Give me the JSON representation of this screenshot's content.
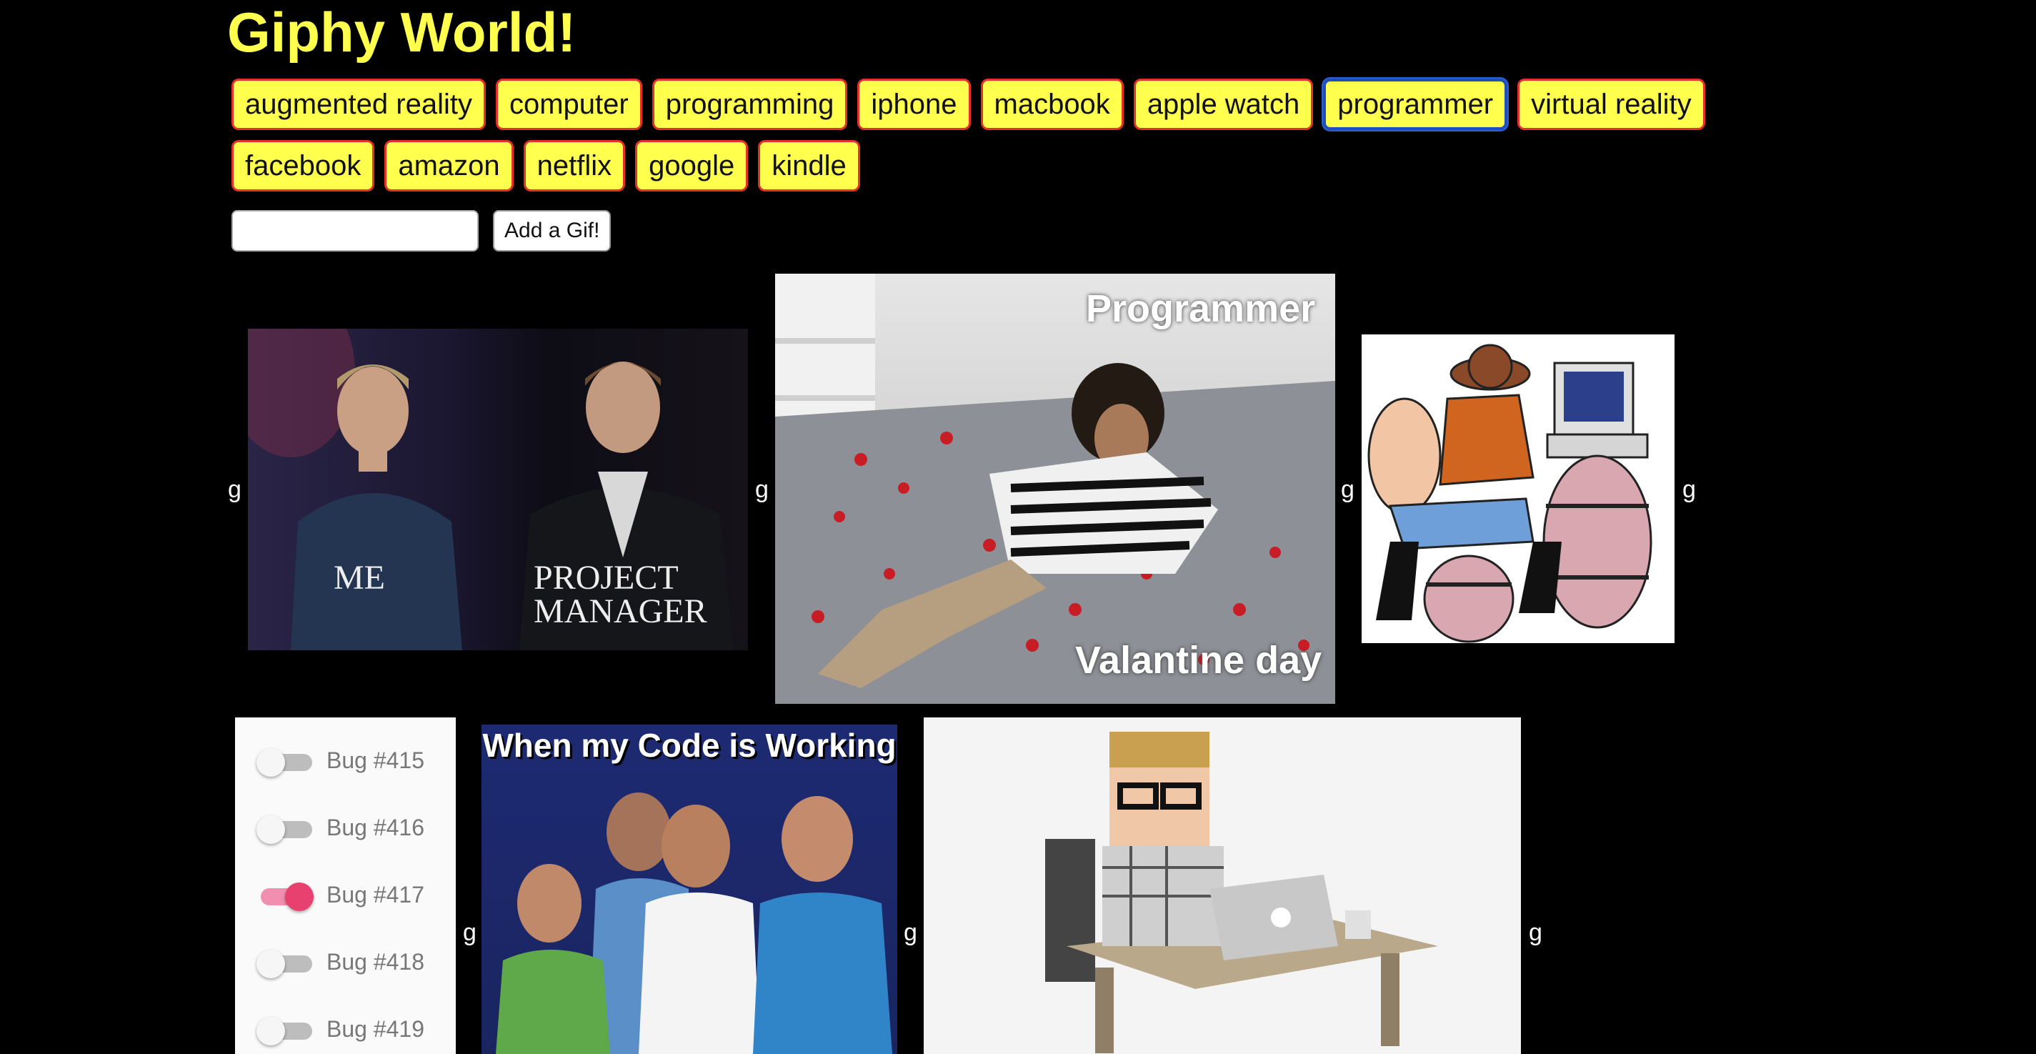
{
  "app": {
    "title": "Giphy World!"
  },
  "topics": {
    "row1": [
      "augmented reality",
      "computer",
      "programming",
      "iphone",
      "macbook",
      "apple watch",
      "programmer",
      "virtual reality"
    ],
    "row2": [
      "facebook",
      "amazon",
      "netflix",
      "google",
      "kindle"
    ],
    "active": "programmer"
  },
  "add_form": {
    "input_value": "",
    "button_label": "Add a Gif!"
  },
  "gifs": [
    {
      "rating": "g",
      "captions": [
        "ME",
        "PROJECT",
        "MANAGER"
      ]
    },
    {
      "rating": "g",
      "captions": [
        "Programmer",
        "Valantine day"
      ]
    },
    {
      "rating": "g",
      "captions": []
    },
    {
      "rating": "g",
      "bugs": [
        {
          "label": "Bug #415",
          "on": false
        },
        {
          "label": "Bug #416",
          "on": false
        },
        {
          "label": "Bug #417",
          "on": true
        },
        {
          "label": "Bug #418",
          "on": false
        },
        {
          "label": "Bug #419",
          "on": false
        }
      ]
    },
    {
      "rating": "g",
      "captions": [
        "When my Code is Working"
      ]
    },
    {
      "rating": "g",
      "captions": []
    }
  ],
  "colors": {
    "background": "#000000",
    "title": "#ffff4d",
    "button_fill": "#ffff4d",
    "button_border": "#e6312b",
    "active_border": "#1f4fbf"
  }
}
